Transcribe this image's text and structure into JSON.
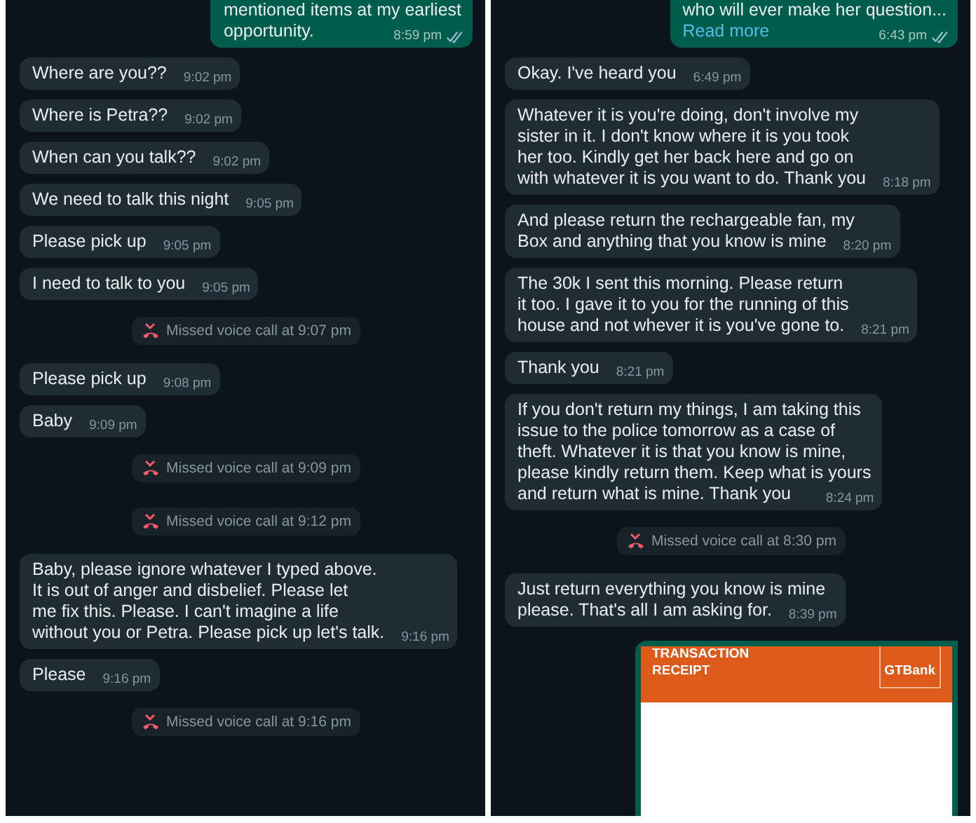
{
  "panels": [
    {
      "messages": [
        {
          "kind": "outgoing",
          "lines": [
            "mentioned items at my earliest",
            "opportunity."
          ],
          "time": "8:59 pm"
        },
        {
          "kind": "incoming",
          "lines": [
            "Where are you??"
          ],
          "time": "9:02 pm"
        },
        {
          "kind": "incoming",
          "lines": [
            "Where is Petra??"
          ],
          "time": "9:02 pm"
        },
        {
          "kind": "incoming",
          "lines": [
            "When can you talk??"
          ],
          "time": "9:02 pm"
        },
        {
          "kind": "incoming",
          "lines": [
            "We need to talk this night"
          ],
          "time": "9:05 pm"
        },
        {
          "kind": "incoming",
          "lines": [
            "Please pick up"
          ],
          "time": "9:05 pm"
        },
        {
          "kind": "incoming",
          "lines": [
            "I need to talk to you"
          ],
          "time": "9:05 pm"
        },
        {
          "kind": "call",
          "text": "Missed voice call at 9:07 pm"
        },
        {
          "kind": "incoming",
          "lines": [
            "Please pick up"
          ],
          "time": "9:08 pm"
        },
        {
          "kind": "incoming",
          "lines": [
            "Baby"
          ],
          "time": "9:09 pm"
        },
        {
          "kind": "call",
          "text": "Missed voice call at 9:09 pm"
        },
        {
          "kind": "call",
          "text": "Missed voice call at 9:12 pm"
        },
        {
          "kind": "incoming",
          "lines": [
            "Baby, please ignore whatever I typed above.",
            "It is out of anger and disbelief.  Please let",
            "me fix this. Please.  I can't imagine a life",
            "without you or Petra. Please pick up let's talk."
          ],
          "time": "9:16 pm"
        },
        {
          "kind": "incoming",
          "lines": [
            "Please"
          ],
          "time": "9:16 pm"
        },
        {
          "kind": "call",
          "text": "Missed voice call at 9:16 pm"
        }
      ]
    },
    {
      "messages": [
        {
          "kind": "outgoing",
          "lines": [
            "who will ever make her question..."
          ],
          "link": "Read more",
          "time": "6:43 pm"
        },
        {
          "kind": "incoming",
          "lines": [
            "Okay. I've heard you"
          ],
          "time": "6:49 pm"
        },
        {
          "kind": "incoming",
          "lines": [
            "Whatever it is you're doing, don't involve my",
            "sister in it. I don't know where it is you took",
            "her too. Kindly get her back here and go on",
            "with whatever it is you want to do. Thank you"
          ],
          "time": "8:18 pm"
        },
        {
          "kind": "incoming",
          "lines": [
            "And please return the rechargeable fan, my",
            "Box and anything that you know is mine"
          ],
          "time": "8:20 pm"
        },
        {
          "kind": "incoming",
          "lines": [
            "The 30k I sent this morning.  Please return",
            "it too. I gave it to you for the running of this",
            "house and not whever it is you've gone to."
          ],
          "time": "8:21 pm"
        },
        {
          "kind": "incoming",
          "lines": [
            "Thank you"
          ],
          "time": "8:21 pm"
        },
        {
          "kind": "incoming",
          "lines": [
            "If you don't return my things, I am taking this",
            "issue to the police tomorrow as a case of",
            "theft. Whatever it is that you know is mine,",
            "please kindly return them. Keep what is yours",
            "and return what is mine. Thank you"
          ],
          "time": "8:24 pm"
        },
        {
          "kind": "call",
          "text": "Missed voice call at 8:30 pm"
        },
        {
          "kind": "incoming",
          "lines": [
            "Just return everything you know is mine",
            "please.  That's all I am asking for."
          ],
          "time": "8:39 pm"
        },
        {
          "kind": "receipt",
          "title_lines": [
            "TRANSACTION",
            "RECEIPT"
          ],
          "logo": "GTBank"
        }
      ]
    }
  ]
}
